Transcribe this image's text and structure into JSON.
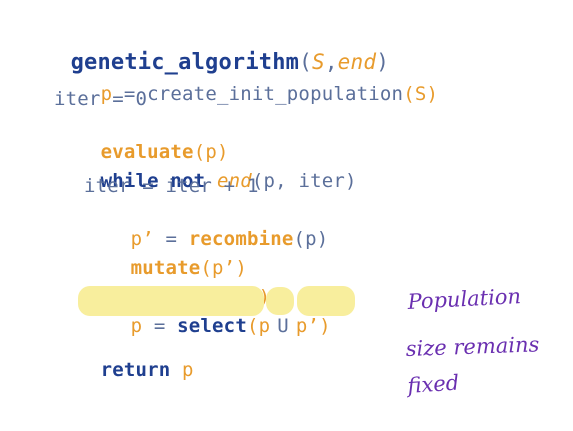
{
  "code": {
    "func_name": "genetic_algorithm",
    "open_paren": "(",
    "param_s": "S",
    "comma": ",",
    "param_end": "end",
    "close_paren": ")",
    "line2_p": "p",
    "line2_eq": " = ",
    "line2_call": "create_init_population",
    "line2_args": "(S)",
    "line3": "iter = 0",
    "line4_fn": "evaluate",
    "line4_args": "(p)",
    "line5_while": "while",
    "line5_not": "not",
    "line5_end": "end",
    "line5_args": "(p, iter)",
    "line6": "iter = iter + 1",
    "line7_var": "p’",
    "line7_eq": " = ",
    "line7_fn": "recombine",
    "line7_args": "(p)",
    "line8_fn": "mutate",
    "line8_args": "(p’)",
    "line9_fn": "evaluate",
    "line9_args": "(p’)",
    "line10_p": "p",
    "line10_eq": " = ",
    "line10_fn": "select",
    "line10_open": "(p",
    "line10_union": "U",
    "line10_arg2": "p’)",
    "line11_return": "return",
    "line11_val": "p"
  },
  "annotation": {
    "line1": "Population",
    "line2": "size remains",
    "line3": "fixed"
  },
  "colors": {
    "keyword": "#1f3f8f",
    "function_call": "#e89b2c",
    "variable": "#e89b2c",
    "highlight": "#f8ee9d",
    "handwriting": "#6a2fb0"
  }
}
